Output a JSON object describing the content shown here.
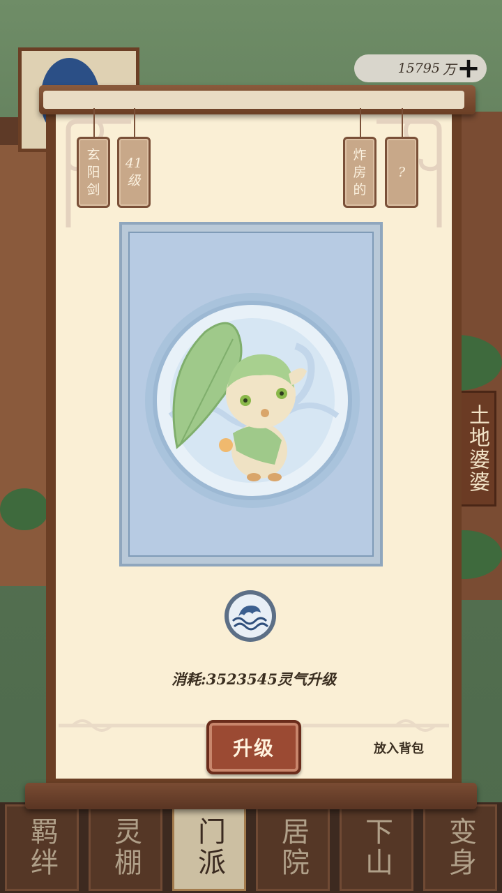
{
  "hud": {
    "currency_amount": "15795",
    "currency_unit": "万",
    "add_symbol": "+"
  },
  "scroll": {
    "left_tags": [
      {
        "chars": [
          "玄",
          "阳",
          "剑"
        ]
      },
      {
        "chars": [
          "41",
          "级"
        ]
      }
    ],
    "right_tags": [
      {
        "chars": [
          "炸",
          "房",
          "的"
        ]
      },
      {
        "chars": [
          "?"
        ]
      }
    ],
    "cost_text": "消耗:3523545灵气升级",
    "upgrade_label": "升级",
    "bag_label": "放入背包"
  },
  "background": {
    "sign_text": "土地婆婆"
  },
  "bottom_nav": {
    "tabs": [
      {
        "label": "羁绊"
      },
      {
        "label": "灵棚"
      },
      {
        "label": "门派",
        "active": true
      },
      {
        "label": "居院"
      },
      {
        "label": "下山"
      },
      {
        "label": "变身"
      }
    ]
  },
  "colors": {
    "paper": "#faefd5",
    "wood": "#6b3f25",
    "card_blue": "#b7cbe3",
    "button_red": "#9b4a33"
  }
}
